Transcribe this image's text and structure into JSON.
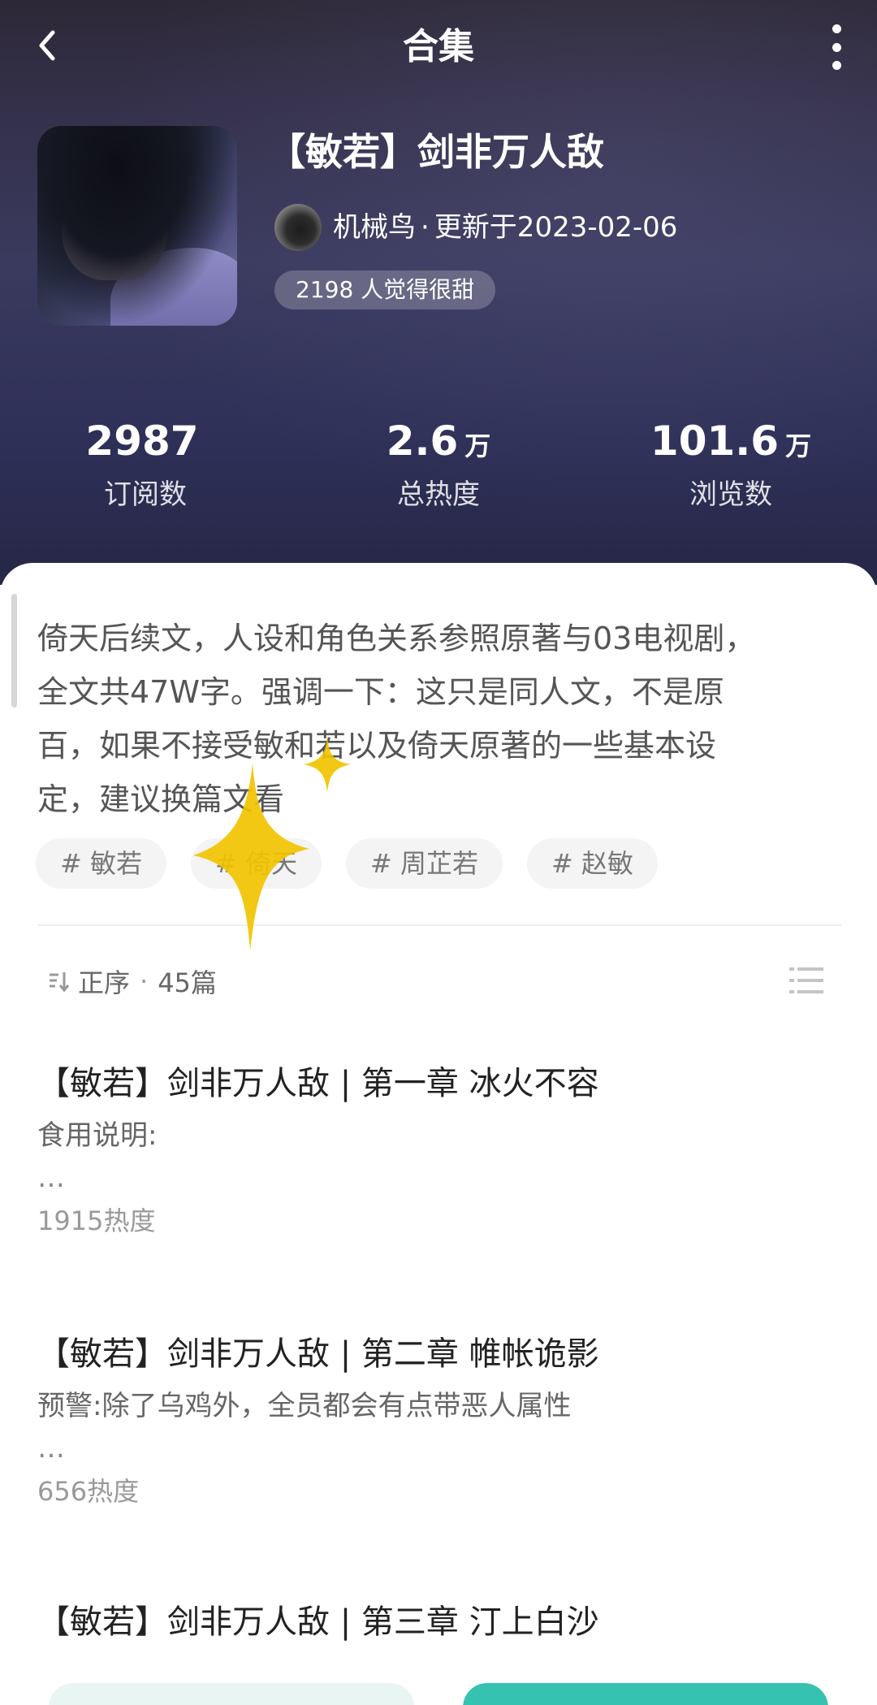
{
  "topbar": {
    "title": "合集",
    "back_icon": "chevron-left-icon",
    "more_icon": "more-vertical-icon"
  },
  "collection": {
    "title": "【敏若】剑非万人敌",
    "author": "机械鸟",
    "separator": "·",
    "updated": "更新于2023-02-06",
    "sweet_badge": "2198 人觉得很甜"
  },
  "stats": [
    {
      "value": "2987",
      "unit": "",
      "label": "订阅数"
    },
    {
      "value": "2.6",
      "unit": "万",
      "label": "总热度"
    },
    {
      "value": "101.6",
      "unit": "万",
      "label": "浏览数"
    }
  ],
  "description": {
    "lines": [
      "倚天后续文，人设和角色关系参照原著与03电视剧，",
      "全文共47W字。强调一下：这只是同人文，不是原",
      "百，如果不接受敏和若以及倚天原著的一些基本设",
      "定，建议换篇文看"
    ]
  },
  "tags": [
    "# 敏若",
    "# 倚天",
    "# 周芷若",
    "# 赵敏"
  ],
  "order": {
    "label": "正序",
    "dot": "·",
    "count": "45篇"
  },
  "episodes": [
    {
      "title": "【敏若】剑非万人敌 | 第一章 冰火不容",
      "desc": "食用说明:",
      "more": "…",
      "heat": "1915热度"
    },
    {
      "title": "【敏若】剑非万人敌 | 第二章  帷帐诡影",
      "desc": "预警:除了乌鸡外，全员都会有点带恶人属性",
      "more": "…",
      "heat": "656热度"
    },
    {
      "title": "【敏若】剑非万人敌 | 第三章 汀上白沙",
      "desc": "",
      "more": "",
      "heat": ""
    }
  ],
  "colors": {
    "header_dark": "#2d2836",
    "header_mid": "#3a3a5e",
    "accent_teal": "#36c2b0",
    "sparkle_yellow": "#f2c300"
  }
}
